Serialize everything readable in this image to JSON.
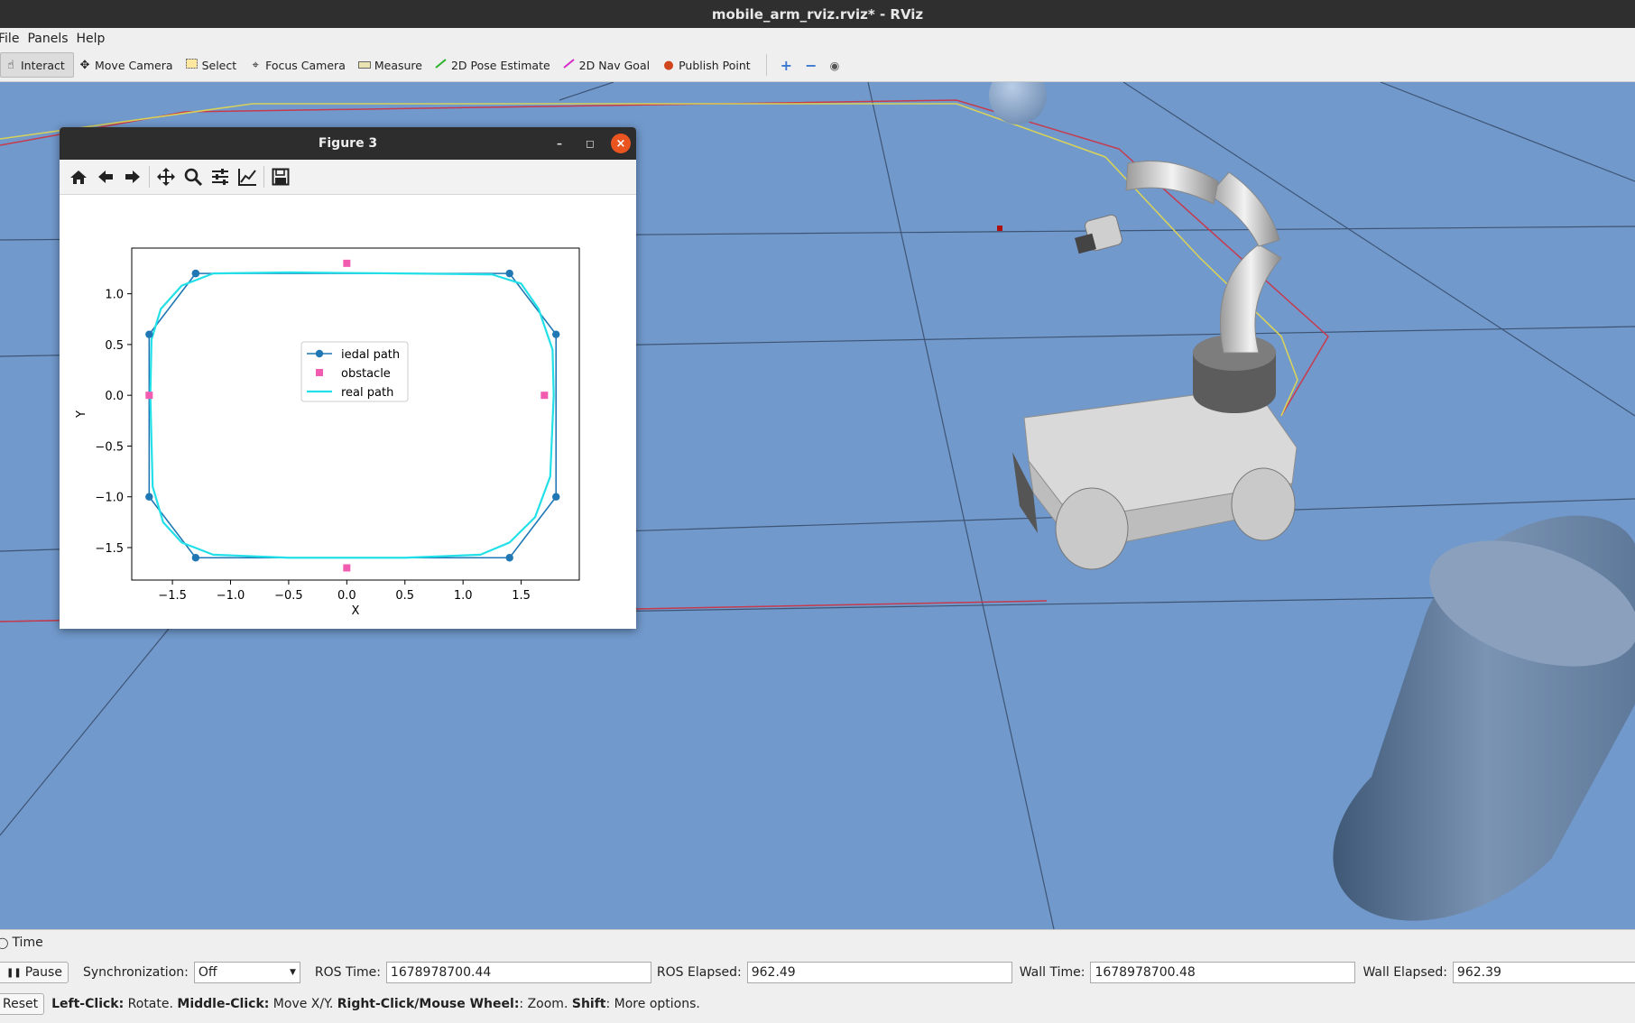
{
  "window": {
    "title": "mobile_arm_rviz.rviz* - RViz"
  },
  "menu": [
    "File",
    "Panels",
    "Help"
  ],
  "toolbar": {
    "tools": [
      {
        "label": "Interact",
        "icon": "hand-icon",
        "active": true
      },
      {
        "label": "Move Camera",
        "icon": "move-camera-icon"
      },
      {
        "label": "Select",
        "icon": "select-icon"
      },
      {
        "label": "Focus Camera",
        "icon": "focus-camera-icon"
      },
      {
        "label": "Measure",
        "icon": "ruler-icon"
      },
      {
        "label": "2D Pose Estimate",
        "icon": "pose-estimate-arrow-icon"
      },
      {
        "label": "2D Nav Goal",
        "icon": "nav-goal-arrow-icon"
      },
      {
        "label": "Publish Point",
        "icon": "map-pin-icon"
      }
    ],
    "extra_icons": [
      "plus-icon",
      "minus-icon",
      "eye-icon"
    ]
  },
  "figure": {
    "title": "Figure 3",
    "tools": [
      "home-icon",
      "back-arrow-icon",
      "forward-arrow-icon",
      "pan-icon",
      "zoom-icon",
      "configure-subplots-icon",
      "edit-axis-icon",
      "save-icon"
    ]
  },
  "chart_data": {
    "type": "line",
    "xlabel": "X",
    "ylabel": "Y",
    "xlim": [
      -1.85,
      2.0
    ],
    "ylim": [
      -1.82,
      1.45
    ],
    "xticks": [
      -1.5,
      -1.0,
      -0.5,
      0.0,
      0.5,
      1.0,
      1.5
    ],
    "xtick_labels": [
      "−1.5",
      "−1.0",
      "−0.5",
      "0.0",
      "0.5",
      "1.0",
      "1.5"
    ],
    "yticks": [
      1.0,
      0.5,
      0.0,
      -0.5,
      -1.0,
      -1.5
    ],
    "ytick_labels": [
      "1.0",
      "0.5",
      "0.0",
      "−0.5",
      "−1.0",
      "−1.5"
    ],
    "legend_position": "center",
    "series": [
      {
        "name": "iedal path",
        "kind": "line-marker",
        "color": "#1f77b4",
        "x": [
          -1.3,
          1.4,
          1.8,
          1.8,
          1.4,
          -1.3,
          -1.7,
          -1.7,
          -1.3
        ],
        "y": [
          1.2,
          1.2,
          0.6,
          -1.0,
          -1.6,
          -1.6,
          -1.0,
          0.6,
          1.2
        ]
      },
      {
        "name": "obstacle",
        "kind": "square-marker",
        "color": "#f25cb0",
        "x": [
          0.0,
          -1.7,
          1.7,
          0.0
        ],
        "y": [
          1.3,
          0.0,
          0.0,
          -1.7
        ]
      },
      {
        "name": "real path",
        "kind": "line",
        "color": "#22e0e8",
        "x": [
          -1.15,
          -0.5,
          0.5,
          1.25,
          1.5,
          1.65,
          1.77,
          1.78,
          1.75,
          1.62,
          1.4,
          1.15,
          0.5,
          -0.5,
          -1.15,
          -1.42,
          -1.58,
          -1.67,
          -1.69,
          -1.68,
          -1.6,
          -1.42,
          -1.15
        ],
        "y": [
          1.2,
          1.21,
          1.2,
          1.19,
          1.1,
          0.85,
          0.45,
          0.0,
          -0.8,
          -1.2,
          -1.45,
          -1.57,
          -1.6,
          -1.6,
          -1.57,
          -1.45,
          -1.25,
          -0.9,
          0.0,
          0.55,
          0.85,
          1.08,
          1.2
        ]
      }
    ]
  },
  "time_panel": {
    "title": "Time",
    "pause_label": "Pause",
    "sync_label": "Synchronization:",
    "sync_value": "Off",
    "ros_time_label": "ROS Time:",
    "ros_time": "1678978700.44",
    "ros_elapsed_label": "ROS Elapsed:",
    "ros_elapsed": "962.49",
    "wall_time_label": "Wall Time:",
    "wall_time": "1678978700.48",
    "wall_elapsed_label": "Wall Elapsed:",
    "wall_elapsed": "962.39"
  },
  "status_bar": {
    "reset_label": "Reset",
    "hint_1_key": "Left-Click:",
    "hint_1_text": " Rotate. ",
    "hint_2_key": "Middle-Click:",
    "hint_2_text": " Move X/Y. ",
    "hint_3_key": "Right-Click/Mouse Wheel:",
    "hint_3_text": ": Zoom. ",
    "hint_4_key": "Shift",
    "hint_4_text": ": More options."
  },
  "colors": {
    "viewport_bg": "#7199cc",
    "accent_close": "#e95420"
  }
}
